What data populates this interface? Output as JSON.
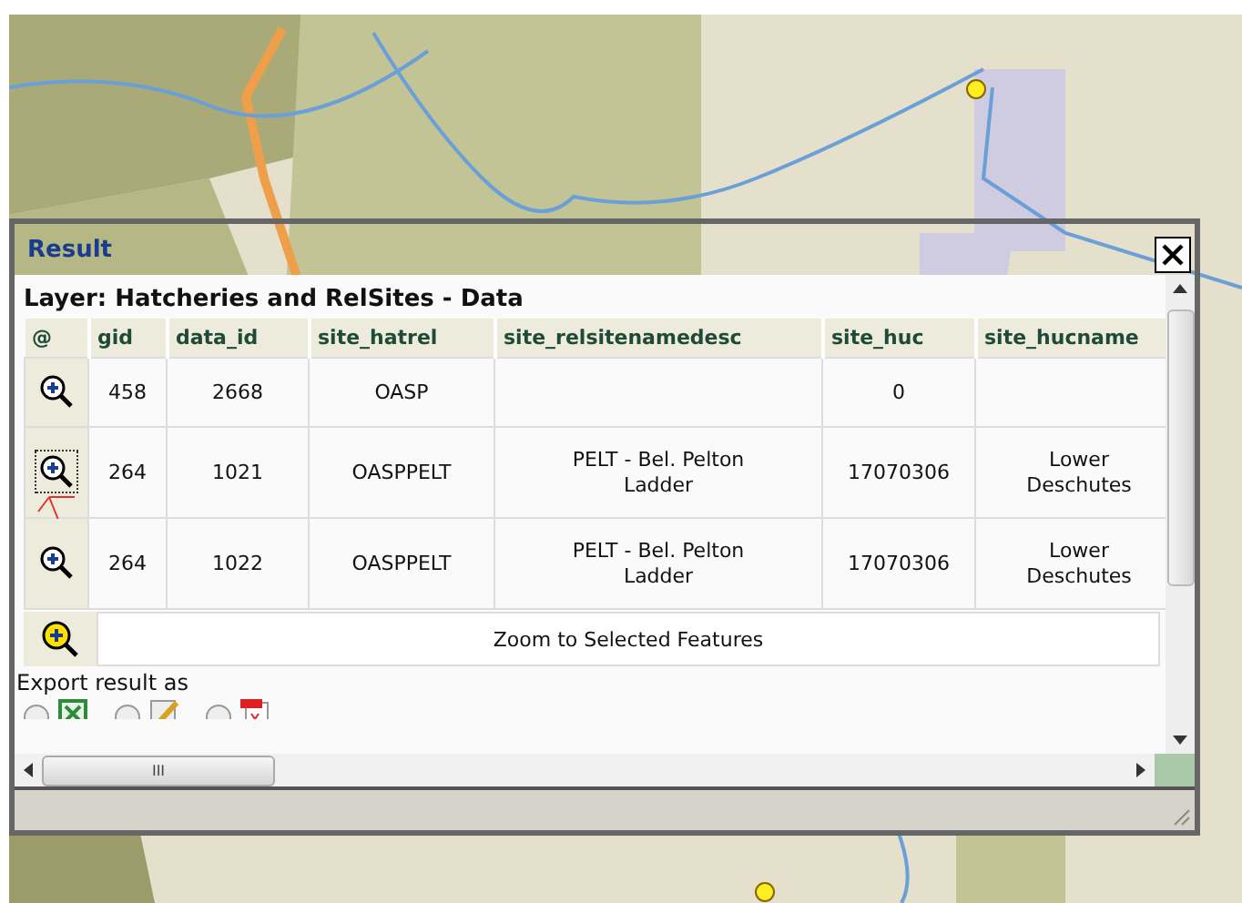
{
  "dialog": {
    "title": "Result",
    "layer_title": "Layer: Hatcheries and RelSites - Data",
    "table": {
      "icon_column": "@",
      "columns": [
        "gid",
        "data_id",
        "site_hatrel",
        "site_relsitenamedesc",
        "site_huc",
        "site_hucname"
      ],
      "rows": [
        {
          "focused": false,
          "cells": [
            "458",
            "2668",
            "OASP",
            "",
            "0",
            ""
          ]
        },
        {
          "focused": true,
          "cells": [
            "264",
            "1021",
            "OASPPELT",
            "PELT - Bel. Pelton Ladder",
            "17070306",
            "Lower Deschutes"
          ]
        },
        {
          "focused": false,
          "cells": [
            "264",
            "1022",
            "OASPPELT",
            "PELT - Bel. Pelton Ladder",
            "17070306",
            "Lower Deschutes"
          ]
        }
      ]
    },
    "zoom_button": "Zoom to Selected Features",
    "export_label": "Export result as",
    "export_options": [
      {
        "kind": "excel",
        "selected": false
      },
      {
        "kind": "text",
        "selected": false
      },
      {
        "kind": "pdf",
        "selected": false
      }
    ],
    "scrollbar_grip": "III"
  }
}
